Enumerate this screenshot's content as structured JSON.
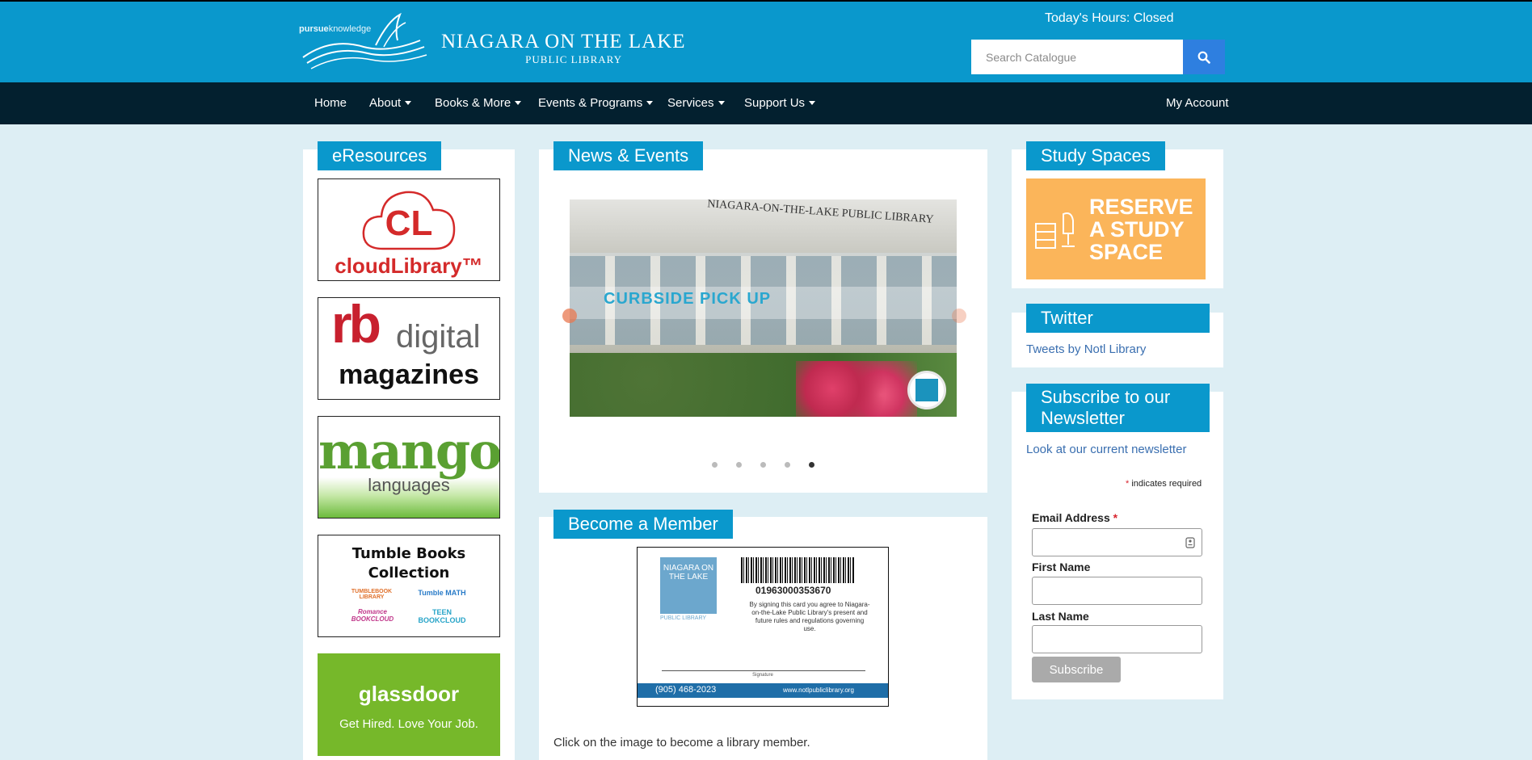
{
  "header": {
    "tagline_bold": "pursue",
    "tagline_rest": "knowledge",
    "title": "NIAGARA ON THE LAKE",
    "subtitle": "PUBLIC LIBRARY",
    "hours": "Today's Hours: Closed",
    "search_placeholder": "Search Catalogue",
    "accent": "#0a98cc"
  },
  "nav": {
    "items": [
      "Home",
      "About",
      "Books & More",
      "Events & Programs",
      "Services",
      "Support Us"
    ],
    "account": "My Account"
  },
  "eresources": {
    "title": "eResources",
    "tiles": [
      {
        "line1": "CL",
        "line2": "cloudLibrary™"
      },
      {
        "line1": "rb",
        "line2": "digital",
        "line3": "magazines"
      },
      {
        "line1": "mango",
        "line2": "languages"
      },
      {
        "line1": "Tumble Books",
        "line2": "Collection",
        "logos": [
          "TUMBLEBOOK LIBRARY",
          "Tumble MATH",
          "Romance BOOKCLOUD",
          "TEEN BOOKCLOUD"
        ]
      },
      {
        "line1": "glassdoor",
        "line2": "Get Hired. Love Your Job."
      }
    ]
  },
  "news": {
    "title": "News & Events",
    "slide_building_text": "NIAGARA-ON-THE-LAKE PUBLIC LIBRARY",
    "slide_caption": "CURBSIDE PICK UP",
    "slide_count": 5,
    "active_slide": 5
  },
  "member": {
    "title": "Become a Member",
    "card_library": "NIAGARA ON THE LAKE",
    "card_library_sub": "PUBLIC LIBRARY",
    "card_number": "01963000353670",
    "card_terms": "By signing this card you agree to Niagara-on-the-Lake Public Library's present and future rules and regulations governing use.",
    "card_signature": "Signature",
    "card_phone": "(905) 468-2023",
    "card_url": "www.notlpubliclibrary.org",
    "caption": "Click on the image to become a library member."
  },
  "study": {
    "title": "Study Spaces",
    "banner_line1": "RESERVE",
    "banner_line2": "A STUDY",
    "banner_line3": "SPACE"
  },
  "twitter": {
    "title": "Twitter",
    "link": "Tweets by Notl Library"
  },
  "newsletter": {
    "title_line1": "Subscribe to our",
    "title_line2": "Newsletter",
    "link": "Look at our current newsletter",
    "required_note": "indicates required",
    "email_label": "Email Address",
    "first_label": "First Name",
    "last_label": "Last Name",
    "subscribe": "Subscribe"
  }
}
